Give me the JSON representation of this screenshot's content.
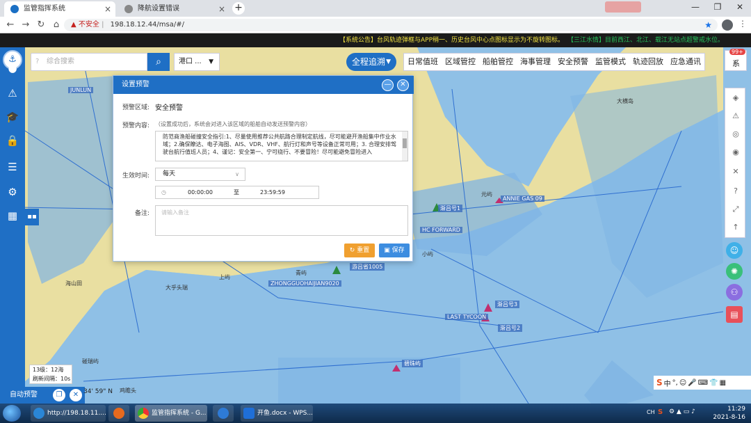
{
  "browser": {
    "tabs": [
      {
        "title": "监管指挥系统",
        "active": true
      },
      {
        "title": "降航设置错误",
        "active": false
      }
    ],
    "security_label": "不安全",
    "url": "198.18.12.44/msa/#/"
  },
  "notice": {
    "system": "【系统公告】台风轨迹弹框与APP稍一、历史台风中心点图标显示为不旋转图标。",
    "water": "【三江水情】目前西江、北江、载江无站点超警戒水位。"
  },
  "search": {
    "placeholder": "综合搜索"
  },
  "port_select": {
    "value": "港口 ..."
  },
  "track_button": {
    "label": "全程追溯"
  },
  "top_nav": [
    "日常值班",
    "区域管控",
    "船舶管控",
    "海事管理",
    "安全预警",
    "监管模式",
    "轨迹回放",
    "应急通讯"
  ],
  "badge": {
    "count": "99+",
    "label": "系"
  },
  "map_labels": {
    "place1": "大横岛",
    "place2": "青屿",
    "place3": "上屿",
    "place4": "大乎头瑞",
    "place5": "海山田",
    "place6": "小屿",
    "place7": "元屿",
    "place8": "碧珠屿",
    "ship1": "JUNLUN",
    "ship2": "ANNIE GAS 09",
    "ship3": "HC FORWARD",
    "ship4": "ZHONGGUOHAIJIAN9020",
    "ship5": "LAST TYCOON",
    "ship6": "渐吕号1",
    "ship7": "渐吕号3",
    "ship8": "渐吕号2",
    "ship9": "游吕省1005",
    "place9": "碰瑞屿",
    "place10": "鸡瞻头"
  },
  "dialog": {
    "title": "设置预警",
    "area_label": "预警区域:",
    "area_value": "安全预警",
    "content_label": "预警内容:",
    "content_hint": "（设置成功后，系统会对进入该区域的船舶自动发送预警内容）",
    "content_text": "防范商渔船碰撞安全指引:1、尽量使用推荐公共航路合理制定航线，尽可能避开渔船集中作业水域；2.确保瞭达、电子海图、AIS、VDR、VHF、航行灯和声号等设备正常可用；3. 合理安排驾驶台航行值班人员；4、谨记：安全第一、宁可绕行、不要冒险！尽可能避免冒险进入",
    "effective_label": "生效时间:",
    "frequency": "每天",
    "time_start": "00:00:00",
    "time_sep": "至",
    "time_end": "23:59:59",
    "remark_label": "备注:",
    "remark_placeholder": "请输入备注",
    "reset_label": "重置",
    "save_label": "保存"
  },
  "scale": {
    "level": "13级：12海",
    "refresh": "刷新间隔：10s"
  },
  "auto_warn": {
    "label": "自动预警"
  },
  "coordinate": "34' 59\" N",
  "ime": {
    "brand": "S",
    "mode": "中"
  },
  "taskbar": {
    "items": [
      "http://198.18.11....",
      "监管指挥系统 - G...",
      "开鱼.docx - WPS..."
    ],
    "tray_lang": "CH",
    "time": "11:29",
    "date": "2021-8-16"
  },
  "colors": {
    "primary": "#1f6fc5",
    "sea": "#8fc0e6",
    "land": "#e9dfa1",
    "reset": "#f0a030",
    "save": "#3d8de0"
  }
}
